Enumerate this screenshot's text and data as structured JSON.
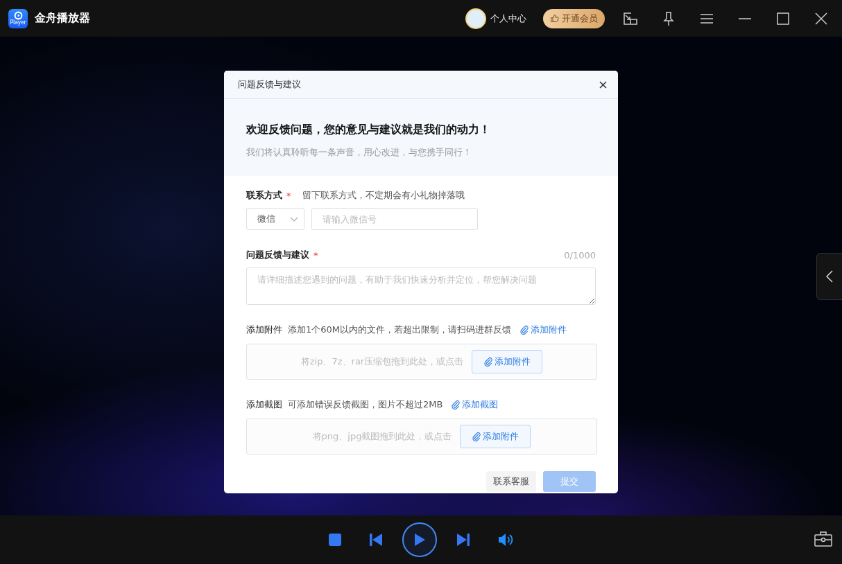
{
  "app": {
    "title": "金舟播放器",
    "logo_text": "Player"
  },
  "header": {
    "user_center": "个人中心",
    "vip_button": "开通会员"
  },
  "dialog": {
    "title": "问题反馈与建议",
    "heading": "欢迎反馈问题，您的意见与建议就是我们的动力！",
    "subheading": "我们将认真聆听每一条声音，用心改进，与您携手同行！",
    "contact": {
      "label": "联系方式",
      "required_mark": "*",
      "hint": "留下联系方式，不定期会有小礼物掉落哦",
      "select_value": "微信",
      "placeholder": "请输入微信号"
    },
    "feedback": {
      "label": "问题反馈与建议",
      "required_mark": "*",
      "counter": "0/1000",
      "placeholder": "请详细描述您遇到的问题，有助于我们快速分析并定位，帮您解决问题"
    },
    "uploads": [
      {
        "label": "添加附件",
        "hint": "添加1个60M以内的文件，若超出限制，请扫码进群反馈",
        "link": "添加附件",
        "drop_text": "将zip、7z、rar压缩包拖到此处，或点击",
        "button": "添加附件"
      },
      {
        "label": "添加截图",
        "hint": "可添加错误反馈截图，图片不超过2MB",
        "link": "添加截图",
        "drop_text": "将png、jpg截图拖到此处，或点击",
        "button": "添加附件"
      }
    ],
    "service_button": "联系客服",
    "submit": {
      "label": "提交",
      "disabled": true
    }
  }
}
